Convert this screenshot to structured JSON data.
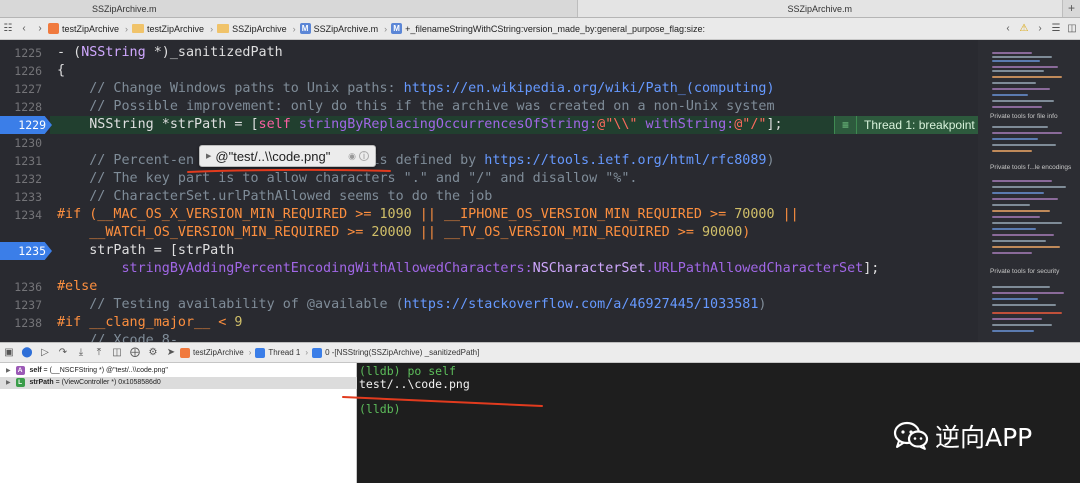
{
  "window_tabs": [
    "SSZipArchive.m",
    "SSZipArchive.m"
  ],
  "jumpbar": {
    "items": [
      "testZipArchive",
      "testZipArchive",
      "SSZipArchive",
      "SSZipArchive.m",
      "+_filenameStringWithCString:version_made_by:general_purpose_flag:size:"
    ],
    "m_badge": "M"
  },
  "gutter": [
    "1225",
    "1226",
    "1227",
    "1228",
    "1229",
    "1230",
    "1231",
    "1232",
    "1233",
    "1234",
    "",
    "1235",
    "",
    "1236",
    "1237",
    "1238",
    ""
  ],
  "code": {
    "l1225_a": "- (",
    "l1225_ty": "NSString",
    "l1225_b": " *)_sanitizedPath",
    "l1226": "{",
    "l1227_cm": "    // Change Windows paths to Unix paths: ",
    "l1227_url": "https://en.wikipedia.org/wiki/Path_(computing)",
    "l1228_cm": "    // Possible improvement: only do this if the archive was created on a non-Unix system",
    "l1229_a": "    NSString *strPath = [",
    "l1229_self": "self",
    "l1229_fn": " stringByReplacingOccurrencesOfString:",
    "l1229_s1": "@\"\\\\\"",
    "l1229_fn2": " withString:",
    "l1229_s2": "@\"/\"",
    "l1229_b": "];",
    "l1231_cm": "    // Percent-en",
    "l1231_cm2": "                 path is defined by ",
    "l1231_url": "https://tools.ietf.org/html/rfc8089",
    "l1231_end": ")",
    "l1232_cm": "    // The key part is to allow characters \".\" and \"/\" and disallow \"%\".",
    "l1233_cm": "    // CharacterSet.urlPathAllowed seems to do the job",
    "l1234_a": "#if (__MAC_OS_X_VERSION_MIN_REQUIRED >= ",
    "l1234_n1": "1090",
    "l1234_b": " || __IPHONE_OS_VERSION_MIN_REQUIRED >= ",
    "l1234_n2": "70000",
    "l1234_c": " ||",
    "l1234x_a": "    __WATCH_OS_VERSION_MIN_REQUIRED >= ",
    "l1234x_n1": "20000",
    "l1234x_b": " || __TV_OS_VERSION_MIN_REQUIRED >= ",
    "l1234x_n2": "90000",
    "l1234x_c": ")",
    "l1235": "    strPath = [strPath",
    "l1235x_fn": "        stringByAddingPercentEncodingWithAllowedCharacters:",
    "l1235x_ty": "NSCharacterSet",
    "l1235x_fn2": ".URLPathAllowedCharacterSet",
    "l1235x_end": "];",
    "l1236": "#else",
    "l1237_cm": "    // Testing availability of @available (",
    "l1237_url": "https://stackoverflow.com/a/46927445/1033581",
    "l1237_end": ")",
    "l1238_a": "#if __clang_major__ < ",
    "l1238_n": "9",
    "l1239_cm": "    // Xcode 8-"
  },
  "thread_badge": "Thread 1: breakpoint",
  "tooltip": {
    "value": "@\"test/..\\\\code.png\""
  },
  "minimap_labels": [
    "Private tools for file info",
    "Private tools f...le encodings",
    "Private tools for security"
  ],
  "debugbar": {
    "crumbs": [
      "testZipArchive",
      "Thread 1",
      "0 -[NSString(SSZipArchive) _sanitizedPath]"
    ]
  },
  "variables": [
    {
      "badge": "A",
      "name": "self",
      "detail": " = (__NSCFString *) @\"test/..\\\\code.png\"",
      "color": "#9b59b6"
    },
    {
      "badge": "L",
      "name": "strPath",
      "detail": " = (ViewController *) 0x1058586d0",
      "color": "#3a9d4a"
    }
  ],
  "console": [
    "(lldb) po self",
    "test/..\\code.png",
    "(lldb)"
  ],
  "watermark": "逆向APP",
  "colors": {
    "breakpoint": "#3b7ee8",
    "annotation": "#e23b1e",
    "lldb_prompt": "#5dbe5b"
  }
}
